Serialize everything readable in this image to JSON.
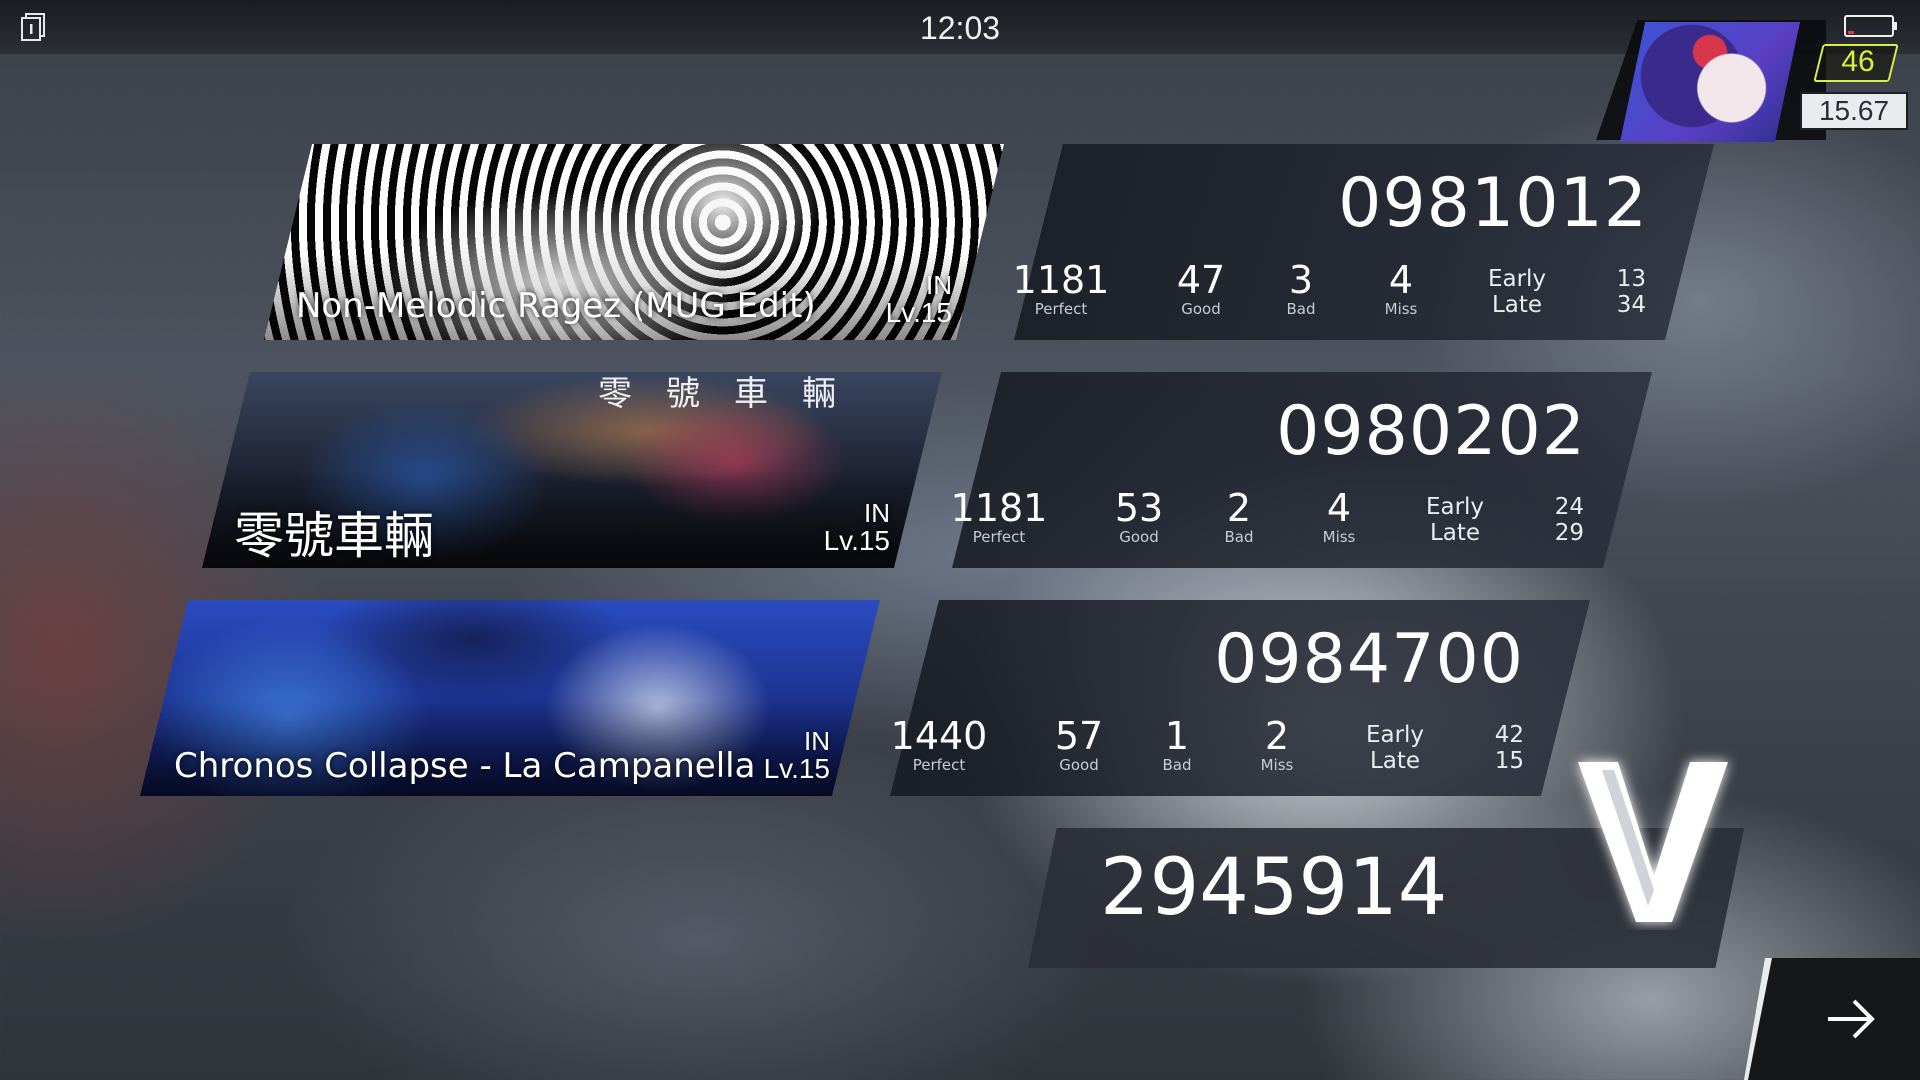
{
  "status_bar": {
    "time": "12:03",
    "left_icon": "document-info-icon",
    "battery_icon": "battery-icon"
  },
  "profile": {
    "level": "46",
    "rating": "15.67",
    "level_color": "#d9f03a"
  },
  "songs": [
    {
      "title": "Non-Melodic Ragez (MUG Edit)",
      "difficulty": "IN",
      "level": "Lv.15",
      "score": "0981012",
      "perfect": "1181",
      "perfect_label": "Perfect",
      "good": "47",
      "good_label": "Good",
      "bad": "3",
      "bad_label": "Bad",
      "miss": "4",
      "miss_label": "Miss",
      "early_label": "Early",
      "late_label": "Late",
      "early": "13",
      "late": "34"
    },
    {
      "title": "零號車輛",
      "art_caption": "零號車輛",
      "difficulty": "IN",
      "level": "Lv.15",
      "score": "0980202",
      "perfect": "1181",
      "perfect_label": "Perfect",
      "good": "53",
      "good_label": "Good",
      "bad": "2",
      "bad_label": "Bad",
      "miss": "4",
      "miss_label": "Miss",
      "early_label": "Early",
      "late_label": "Late",
      "early": "24",
      "late": "29"
    },
    {
      "title": "Chronos Collapse - La Campanella",
      "difficulty": "IN",
      "level": "Lv.15",
      "score": "0984700",
      "perfect": "1440",
      "perfect_label": "Perfect",
      "good": "57",
      "good_label": "Good",
      "bad": "1",
      "bad_label": "Bad",
      "miss": "2",
      "miss_label": "Miss",
      "early_label": "Early",
      "late_label": "Late",
      "early": "42",
      "late": "15"
    }
  ],
  "total": {
    "score": "2945914",
    "rank": "V"
  },
  "next_button_icon": "arrow-right-icon"
}
